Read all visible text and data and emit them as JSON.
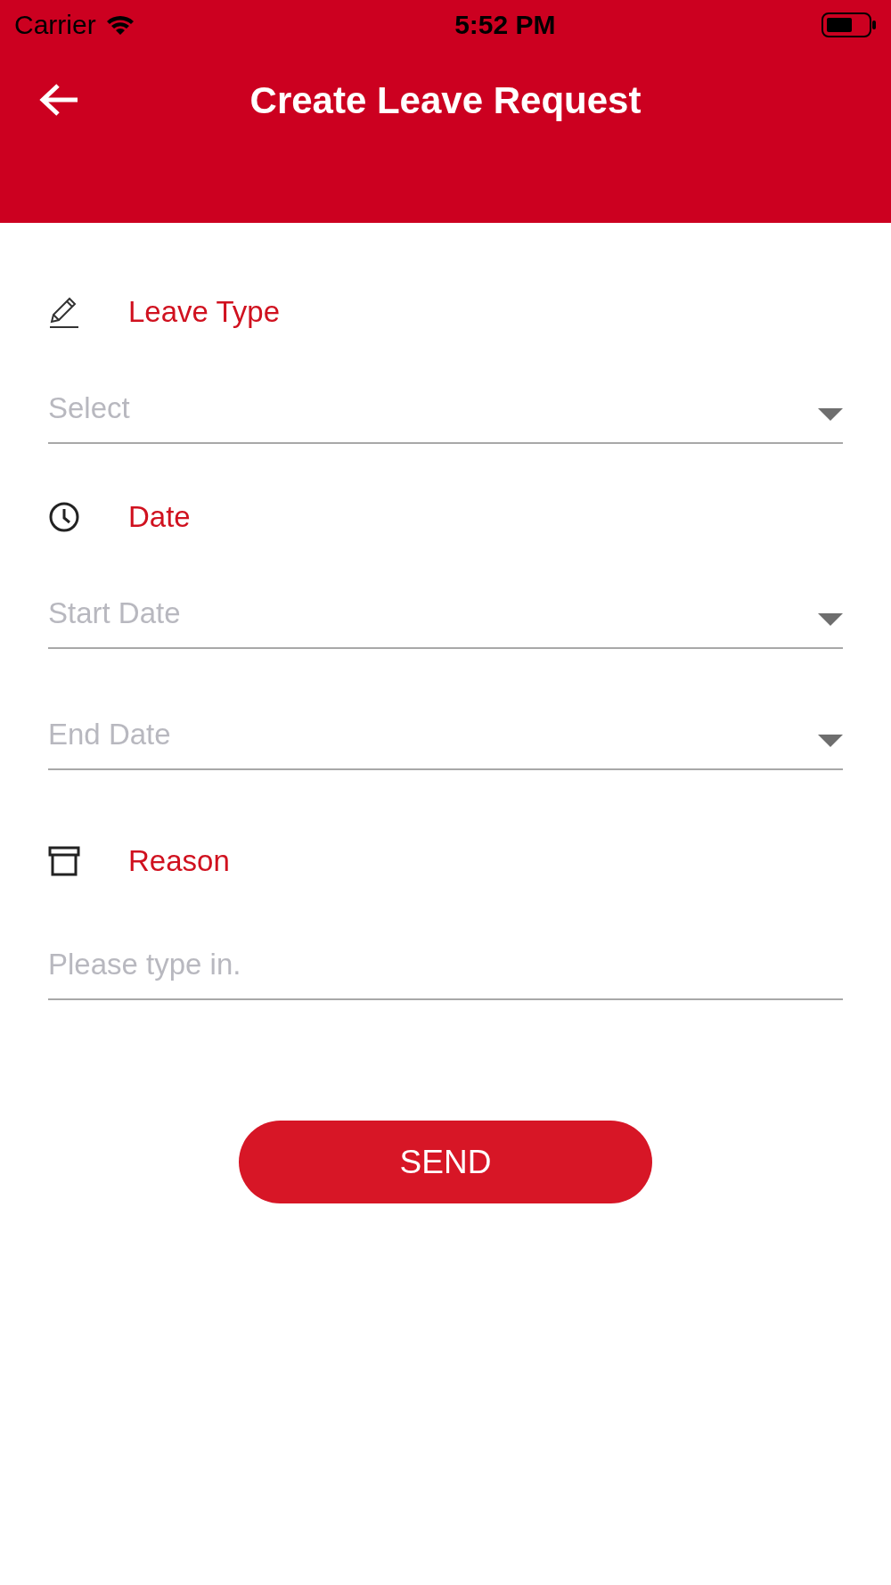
{
  "status_bar": {
    "carrier": "Carrier",
    "time": "5:52 PM"
  },
  "header": {
    "title": "Create Leave Request"
  },
  "sections": [
    {
      "label": "Leave Type",
      "fields": [
        {
          "kind": "dropdown",
          "placeholder": "Select"
        }
      ]
    },
    {
      "label": "Date",
      "fields": [
        {
          "kind": "dropdown",
          "placeholder": "Start Date"
        },
        {
          "kind": "dropdown",
          "placeholder": "End Date"
        }
      ]
    },
    {
      "label": "Reason",
      "fields": [
        {
          "kind": "text",
          "placeholder": "Please type in."
        }
      ]
    }
  ],
  "submit": {
    "label": "SEND"
  }
}
